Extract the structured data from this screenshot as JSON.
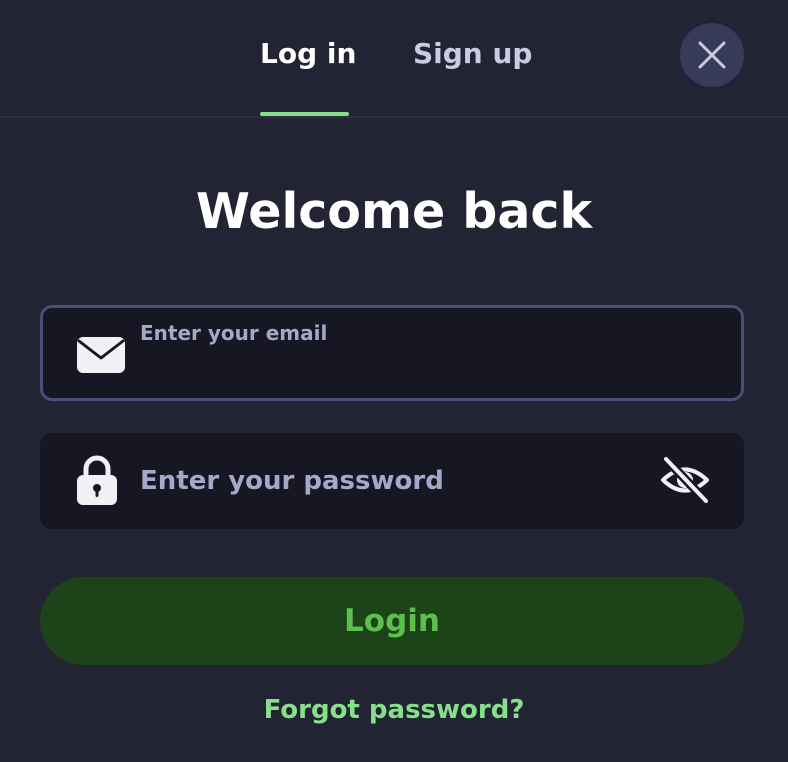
{
  "tabs": {
    "login_label": "Log in",
    "signup_label": "Sign up",
    "active": "Log in"
  },
  "close_icon": "close-icon",
  "heading": "Welcome back",
  "email": {
    "placeholder": "Enter your email",
    "value": "",
    "icon": "envelope-icon"
  },
  "password": {
    "placeholder": "Enter your password",
    "value": "",
    "icon": "lock-icon",
    "toggle_icon": "eye-off-icon"
  },
  "login_button": "Login",
  "forgot_link": "Forgot password?",
  "colors": {
    "background": "#232433",
    "accent": "#86e08a",
    "button_bg": "#1d4318",
    "button_text": "#5cc04d",
    "field_bg": "#161722",
    "field_border": "#4a4f78",
    "placeholder": "#a5a8c9"
  }
}
